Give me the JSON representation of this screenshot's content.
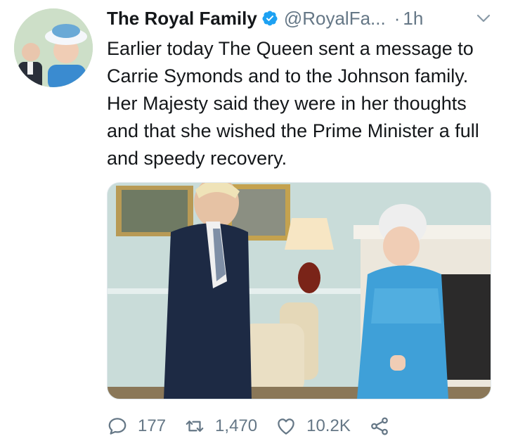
{
  "tweet": {
    "display_name": "The Royal Family",
    "handle": "@RoyalFa...",
    "separator": "·",
    "time": "1h",
    "text": "Earlier today The Queen sent a message to Carrie Symonds and to the Johnson family. Her Majesty said they were in her thoughts and that she wished the Prime Minister a full and speedy recovery."
  },
  "actions": {
    "replies": "177",
    "retweets": "1,470",
    "likes": "10.2K"
  },
  "icons": {
    "verified": "verified-badge-icon",
    "caret": "chevron-down-icon",
    "reply": "reply-icon",
    "retweet": "retweet-icon",
    "like": "heart-icon",
    "share": "share-icon"
  },
  "colors": {
    "verified_blue": "#1da1f2",
    "secondary_text": "#657786",
    "primary_text": "#14171a"
  }
}
